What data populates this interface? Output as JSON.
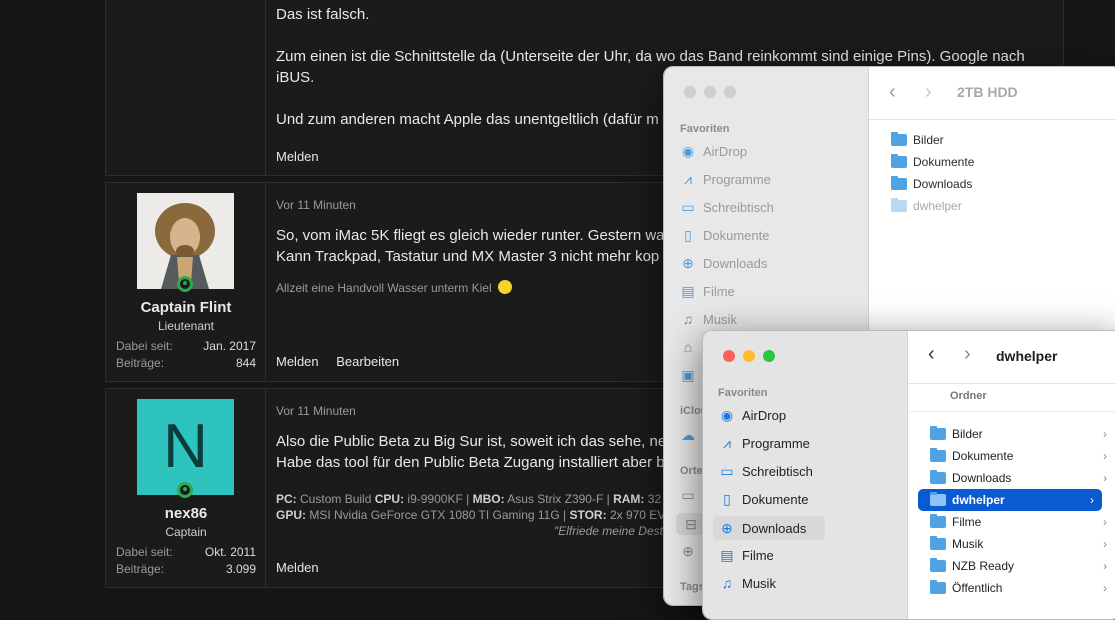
{
  "post1": {
    "line1": "Das ist falsch.",
    "line2": "Zum einen ist die Schnittstelle da (Unterseite der Uhr, da wo das Band reinkommt sind einige Pins). Google nach",
    "line3": "iBUS.",
    "line4": "Und zum anderen macht Apple das unentgeltlich (dafür m",
    "report": "Melden"
  },
  "post2": {
    "username": "Captain Flint",
    "rank": "Lieutenant",
    "joined_label": "Dabei seit:",
    "joined": "Jan. 2017",
    "posts_label": "Beiträge:",
    "posts": "844",
    "time": "Vor 11 Minuten",
    "line1": "So, vom iMac 5K fliegt es gleich wieder runter. Gestern wa",
    "line2": "Kann Trackpad, Tastatur und MX Master 3 nicht mehr kop",
    "signature": "Allzeit eine Handvoll Wasser unterm Kiel",
    "report": "Melden",
    "edit": "Bearbeiten"
  },
  "post3": {
    "avatar_letter": "N",
    "username": "nex86",
    "rank": "Captain",
    "joined_label": "Dabei seit:",
    "joined": "Okt. 2011",
    "posts_label": "Beiträge:",
    "posts": "3.099",
    "time": "Vor 11 Minuten",
    "line1": "Also die Public Beta zu Big Sur ist, soweit ich das sehe, ne",
    "line2": "Habe das tool für den Public Beta Zugang installiert aber b",
    "sig_cpu_label": "PC:",
    "sig_line1_a": "Custom Build",
    "sig_cpu": "CPU:",
    "sig_cpu_val": "i9-9900KF |",
    "sig_mobo": "MBO:",
    "sig_mobo_val": "Asus Strix Z390-F |",
    "sig_ram": "RAM:",
    "sig_ram_val": "32",
    "sig_gpu": "GPU:",
    "sig_gpu_val": "MSI Nvidia GeForce GTX 1080 TI Gaming 11G |",
    "sig_stor": "STOR:",
    "sig_stor_val": "2x 970 EVO",
    "sig_quote": "\"Elfriede meine Dest",
    "report": "Melden"
  },
  "finder_back": {
    "title": "2TB HDD",
    "favorites_header": "Favoriten",
    "icloud_header": "iClou",
    "places_header": "Orte",
    "tags_header": "Tags",
    "sidebar": [
      "AirDrop",
      "Programme",
      "Schreibtisch",
      "Dokumente",
      "Downloads",
      "Filme",
      "Musik"
    ],
    "files": [
      "Bilder",
      "Dokumente",
      "Downloads",
      "dwhelper"
    ]
  },
  "finder_front": {
    "title": "dwhelper",
    "favorites_header": "Favoriten",
    "column_header": "Ordner",
    "sidebar": [
      "AirDrop",
      "Programme",
      "Schreibtisch",
      "Dokumente",
      "Downloads",
      "Filme",
      "Musik"
    ],
    "files": [
      "Bilder",
      "Dokumente",
      "Downloads",
      "dwhelper",
      "Filme",
      "Musik",
      "NZB Ready",
      "Öffentlich"
    ],
    "selected": "dwhelper"
  },
  "colors": {
    "accent": "#0a5ad2",
    "online": "#2fa84f",
    "avatar_teal": "#2ec4bd"
  }
}
